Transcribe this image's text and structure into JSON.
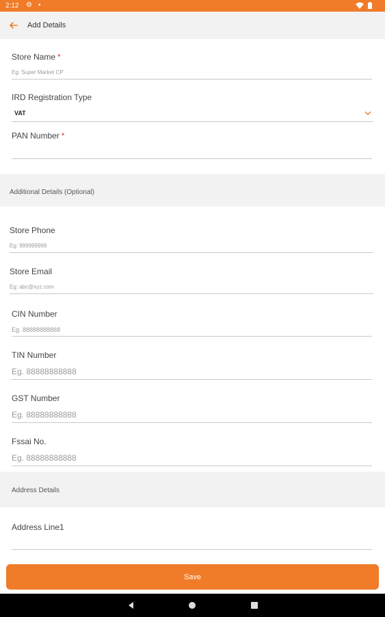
{
  "status_bar": {
    "time": "2:12",
    "icons": [
      "gear-icon",
      "sim-icon",
      "wifi-icon",
      "battery-icon"
    ]
  },
  "app_bar": {
    "title": "Add Details",
    "back_icon": "arrow-left-icon"
  },
  "store_name": {
    "label": "Store Name",
    "required": "*",
    "placeholder": "Eg: Super Market CP"
  },
  "ird_type": {
    "label": "IRD Registration Type",
    "value": "VAT"
  },
  "pan": {
    "label": "PAN Number",
    "required": "*",
    "placeholder": ""
  },
  "additional_section": {
    "title": "Additional Details (Optional)"
  },
  "store_phone": {
    "label": "Store Phone",
    "placeholder": "Eg: 999999999"
  },
  "store_email": {
    "label": "Store Email",
    "placeholder": "Eg: abc@xyz.com"
  },
  "cin": {
    "label": "CIN Number",
    "placeholder": "Eg. 88888888888"
  },
  "tin": {
    "label": "TIN Number",
    "placeholder": "Eg. 88888888888"
  },
  "gst": {
    "label": "GST Number",
    "placeholder": "Eg. 88888888888"
  },
  "fssai": {
    "label": "Fssai No.",
    "placeholder": "Eg. 88888888888"
  },
  "address_section": {
    "title": "Address Details"
  },
  "address_line1": {
    "label": "Address Line1",
    "placeholder": ""
  },
  "save": {
    "label": "Save"
  },
  "colors": {
    "accent": "#f07b28",
    "required": "#e53935",
    "section_bg": "#f2f2f2"
  }
}
